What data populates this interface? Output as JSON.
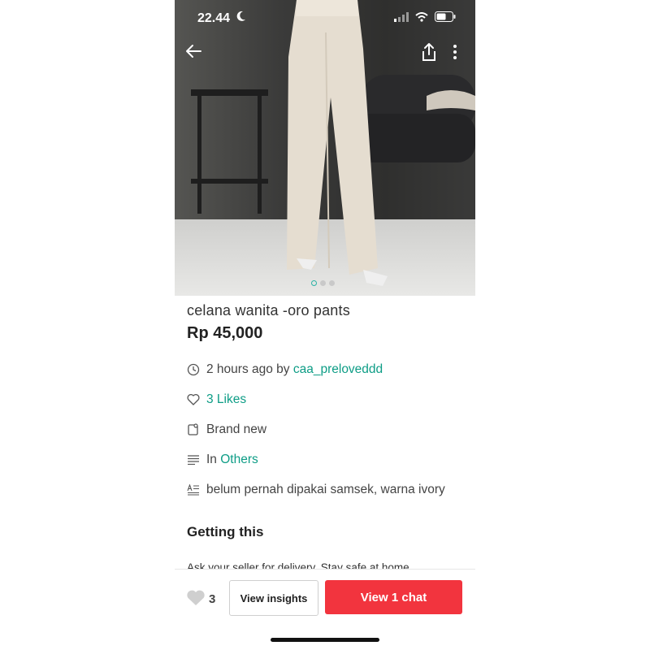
{
  "status_bar": {
    "time": "22.44"
  },
  "gallery": {
    "page_count": 3,
    "active_index": 0
  },
  "listing": {
    "title": "celana wanita -oro pants",
    "price": "Rp 45,000",
    "posted_prefix": "2 hours ago by ",
    "seller": "caa_preloveddd",
    "likes_label": "3 Likes",
    "condition": "Brand new",
    "category_prefix": "In ",
    "category": "Others",
    "description": "belum pernah dipakai samsek, warna ivory"
  },
  "getting_this": {
    "title": "Getting this",
    "note": "Ask your seller for delivery. Stay safe at home."
  },
  "bottom_bar": {
    "like_count": "3",
    "insights_label": "View insights",
    "chat_label": "View 1 chat"
  },
  "colors": {
    "accent": "#0e9d86",
    "chat_button": "#f2343e"
  }
}
